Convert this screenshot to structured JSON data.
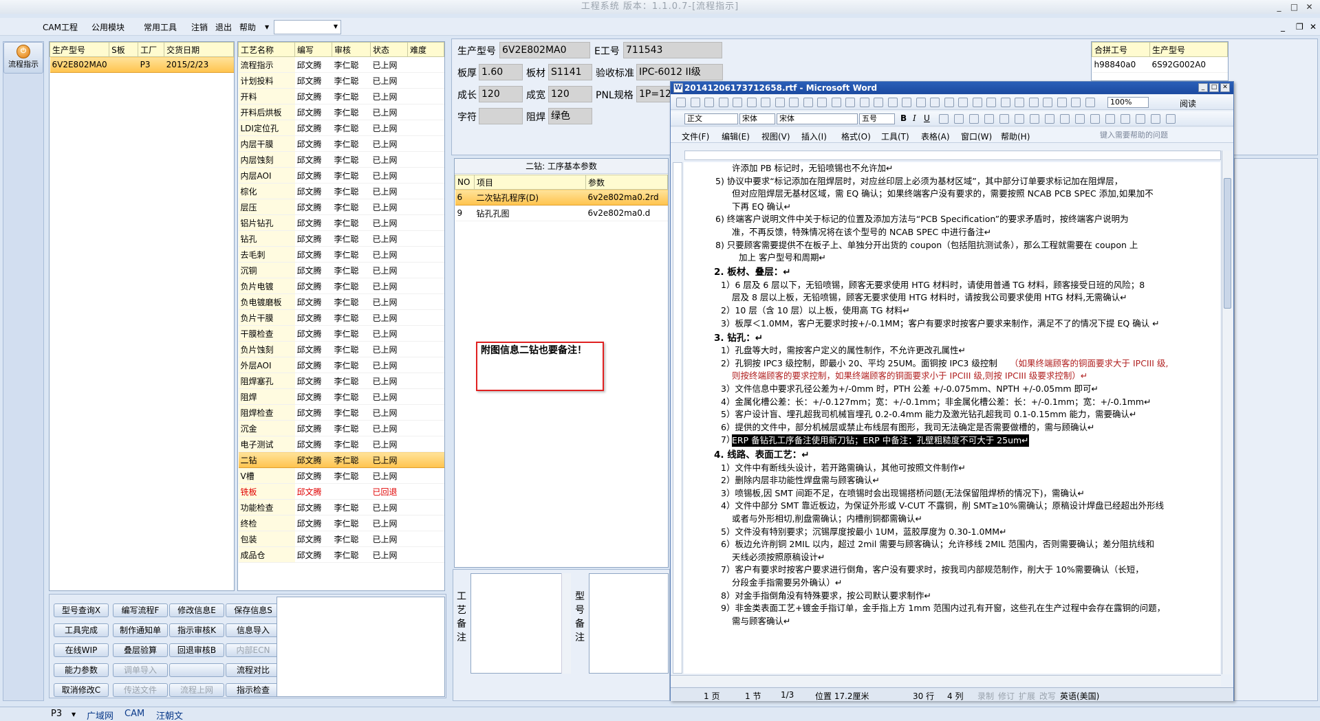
{
  "window": {
    "title": "工程系统 版本：1.1.0.7-[流程指示]"
  },
  "menu": {
    "items": [
      "CAM工程",
      "公用模块",
      "常用工具",
      "注销",
      "退出",
      "帮助"
    ]
  },
  "nav": {
    "label": "流程指示"
  },
  "orders": {
    "headers": [
      "生产型号",
      "S板",
      "工厂",
      "交货日期"
    ],
    "rows": [
      [
        "6V2E802MA0",
        "",
        "P3",
        "2015/2/23"
      ]
    ]
  },
  "process": {
    "headers": [
      "工艺名称",
      "编写",
      "审核",
      "状态",
      "难度"
    ],
    "rows": [
      [
        "流程指示",
        "邱文腾",
        "李仁聪",
        "已上网"
      ],
      [
        "计划投料",
        "邱文腾",
        "李仁聪",
        "已上网"
      ],
      [
        "开料",
        "邱文腾",
        "李仁聪",
        "已上网"
      ],
      [
        "开料后烘板",
        "邱文腾",
        "李仁聪",
        "已上网"
      ],
      [
        "LDI定位孔",
        "邱文腾",
        "李仁聪",
        "已上网"
      ],
      [
        "内层干膜",
        "邱文腾",
        "李仁聪",
        "已上网"
      ],
      [
        "内层蚀刻",
        "邱文腾",
        "李仁聪",
        "已上网"
      ],
      [
        "内层AOI",
        "邱文腾",
        "李仁聪",
        "已上网"
      ],
      [
        "棕化",
        "邱文腾",
        "李仁聪",
        "已上网"
      ],
      [
        "层压",
        "邱文腾",
        "李仁聪",
        "已上网"
      ],
      [
        "铝片钻孔",
        "邱文腾",
        "李仁聪",
        "已上网"
      ],
      [
        "钻孔",
        "邱文腾",
        "李仁聪",
        "已上网"
      ],
      [
        "去毛刺",
        "邱文腾",
        "李仁聪",
        "已上网"
      ],
      [
        "沉铜",
        "邱文腾",
        "李仁聪",
        "已上网"
      ],
      [
        "负片电镀",
        "邱文腾",
        "李仁聪",
        "已上网"
      ],
      [
        "负电镀磨板",
        "邱文腾",
        "李仁聪",
        "已上网"
      ],
      [
        "负片干膜",
        "邱文腾",
        "李仁聪",
        "已上网"
      ],
      [
        "干膜检查",
        "邱文腾",
        "李仁聪",
        "已上网"
      ],
      [
        "负片蚀刻",
        "邱文腾",
        "李仁聪",
        "已上网"
      ],
      [
        "外层AOI",
        "邱文腾",
        "李仁聪",
        "已上网"
      ],
      [
        "阻焊塞孔",
        "邱文腾",
        "李仁聪",
        "已上网"
      ],
      [
        "阻焊",
        "邱文腾",
        "李仁聪",
        "已上网"
      ],
      [
        "阻焊检查",
        "邱文腾",
        "李仁聪",
        "已上网"
      ],
      [
        "沉金",
        "邱文腾",
        "李仁聪",
        "已上网"
      ],
      [
        "电子测试",
        "邱文腾",
        "李仁聪",
        "已上网"
      ],
      [
        "二钻",
        "邱文腾",
        "李仁聪",
        "已上网"
      ],
      [
        "V槽",
        "邱文腾",
        "李仁聪",
        "已上网"
      ],
      [
        "铣板",
        "邱文腾",
        "",
        "已回退"
      ],
      [
        "功能检查",
        "邱文腾",
        "李仁聪",
        "已上网"
      ],
      [
        "终检",
        "邱文腾",
        "李仁聪",
        "已上网"
      ],
      [
        "包装",
        "邱文腾",
        "李仁聪",
        "已上网"
      ],
      [
        "成品仓",
        "邱文腾",
        "李仁聪",
        "已上网"
      ]
    ]
  },
  "form": {
    "model_label": "生产型号",
    "model_value": "6V2E802MA0",
    "eng_label": "E工号",
    "eng_value": "711543",
    "thick_label": "板厚",
    "thick_value": "1.60",
    "mat_label": "板材",
    "mat_value": "S1141",
    "std_label": "验收标准",
    "std_value": "IPC-6012 II级",
    "len_label": "成长",
    "len_value": "120",
    "wid_label": "成宽",
    "wid_value": "120",
    "pnl_label": "PNL规格",
    "pnl_value": "1P=12",
    "char_label": "字符",
    "char_value": "",
    "mask_label": "阻焊",
    "mask_value": "绿色"
  },
  "params": {
    "title": "二钻: 工序基本参数",
    "headers": [
      "NO",
      "项目",
      "参数"
    ],
    "rows": [
      [
        "6",
        "二次钻孔程序(D)",
        "6v2e802ma0.2rd"
      ],
      [
        "9",
        "钻孔孔图",
        "6v2e802ma0.d"
      ]
    ]
  },
  "note": {
    "text": "附图信息二钻也要备注！"
  },
  "remarks": {
    "process_label": "工艺备注",
    "model_label": "型号备注"
  },
  "merged": {
    "headers": [
      "合拼工号",
      "生产型号"
    ],
    "rows": [
      [
        "h98840a0",
        "6S92G002A0"
      ]
    ]
  },
  "buttons": {
    "rows": [
      [
        "型号查询X",
        "编写流程F",
        "修改信息E",
        "保存信息S"
      ],
      [
        "工具完成",
        "制作通知单",
        "指示审核K",
        "信息导入"
      ],
      [
        "在线WIP",
        "叠层验算",
        "回退审核B",
        "内部ECN"
      ],
      [
        "能力参数",
        "调单导入",
        "",
        "流程对比"
      ],
      [
        "取消修改C",
        "传送文件",
        "流程上网",
        "指示检查"
      ]
    ]
  },
  "word": {
    "title": "20141206173712658.rtf - Microsoft Word",
    "style": "正文",
    "font_cn": "宋体",
    "font": "宋体",
    "size": "五号",
    "zoom": "100%",
    "read": "阅读",
    "menu": [
      "文件(F)",
      "编辑(E)",
      "视图(V)",
      "插入(I)",
      "格式(O)",
      "工具(T)",
      "表格(A)",
      "窗口(W)",
      "帮助(H)"
    ],
    "help_placeholder": "键入需要帮助的问题",
    "lines": [
      "许添加 PB 标记时，无铅喷锡也不允许加↵",
      "5)  协议中要求“标记添加在阻焊层时，对应丝印层上必须为基材区域”，其中部分订单要求标记加在阻焊层，",
      "但对应阻焊层无基材区域，需 EQ 确认；如果终端客户没有要求的，需要按照 NCAB PCB SPEC 添加,如果加不",
      "下再 EQ 确认↵",
      "6)  终端客户说明文件中关于标记的位置及添加方法与“PCB Specification”的要求矛盾时，按终端客户说明为",
      "准，不再反馈，特殊情况将在该个型号的 NCAB SPEC 中进行备注↵",
      "8)  只要顾客需要提供不在板子上、单独分开出货的 coupon（包括阻抗测试条），那么工程就需要在 coupon 上",
      "加上 客户型号和周期↵",
      "2.   板材、叠层：↵",
      "1）6 层及 6 层以下，无铅喷锡，顾客无要求使用 HTG 材料时，请使用普通 TG 材料，顾客接受日班的风险；8",
      "层及 8 层以上板，无铅喷锡，顾客无要求使用 HTG 材料时，请按我公司要求使用 HTG 材料,无需确认↵",
      "2）10 层（含 10 层）以上板，使用高 TG 材料↵",
      "3）板厚＜1.0MM，客户无要求时按+/-0.1MM；客户有要求时按客户要求来制作，满足不了的情况下提 EQ 确认   ↵",
      "3.   钻孔：↵",
      "1）孔盘等大时，需按客户定义的属性制作，不允许更改孔属性↵",
      "2）孔铜按 IPC3 级控制，即最小 20、平均 25UM。面铜按 IPC3 级控制",
      "则按终端顾客的要求控制，如果终端顾客的铜面要求小于 IPCIII 级,则按 IPCIII 级要求控制）↵",
      "3）文件信息中要求孔径公差为+/-0mm 时，PTH 公差 +/-0.075mm、NPTH +/-0.05mm 即可↵",
      "4）金属化槽公差：长：+/-0.127mm；宽：+/-0.1mm；非金属化槽公差：长：+/-0.1mm；宽：+/-0.1mm↵",
      "5）客户设计盲、埋孔超我司机械盲埋孔 0.2-0.4mm 能力及激光钻孔超我司 0.1-0.15mm 能力，需要确认↵",
      "6）提供的文件中，部分机械层或禁止布线层有图形，我司无法确定是否需要做槽的，需与顾确认↵",
      "7）",
      "ERP 备钻孔工序备注使用新刀钻；ERP 中备注：孔壁粗糙度不可大于 25um↵",
      "4.   线路、表面工艺：↵",
      "1）文件中有断线头设计，若开路需确认，其他可按照文件制作↵",
      "2）删除内层非功能性焊盘需与顾客确认↵",
      "3）喷锡板,因 SMT 间距不足，在喷锡时会出现锡搭桥问题(无法保留阻焊桥的情况下)，需确认↵",
      "4）文件中部分 SMT 靠近板边，为保证外形或 V-CUT 不露铜，削 SMT≥10%需确认；原稿设计焊盘已经超出外形线",
      "或者与外形相切,削盘需确认；内槽削铜都需确认↵",
      "5）文件没有特别要求；沉锡厚度按最小 1UM，蓝胶厚度为 0.30-1.0MM↵",
      "6）板边允许削铜 2MIL 以内，超过 2mil 需要与顾客确认；允许移线 2MIL 范围内，否则需要确认；差分阻抗线和",
      "天线必须按照原稿设计↵",
      "7）客户有要求时按客户要求进行倒角，客户没有要求时，按我司内部规范制作，削大于 10%需要确认（长短，",
      "分段金手指需要另外确认）↵",
      "8）对金手指倒角没有特殊要求，按公司默认要求制作↵",
      "9）非金类表面工艺+镀金手指订单，金手指上方 1mm 范围内过孔有开窗，这些孔在生产过程中会存在露铜的问题，",
      "需与顾客确认↵"
    ],
    "red_text": "（如果终端顾客的铜面要求大于 IPCIII 级,",
    "status": {
      "page": "1 页",
      "section": "1 节",
      "pages": "1/3",
      "pos": "位置 17.2厘米",
      "line": "30 行",
      "col": "4 列",
      "rec": "录制",
      "rev": "修订",
      "ext": "扩展",
      "ovr": "改写",
      "lang": "英语(美国)"
    }
  },
  "bottom": {
    "factory": "P3",
    "net": "广域网",
    "module": "CAM",
    "user": "汪朝文"
  }
}
